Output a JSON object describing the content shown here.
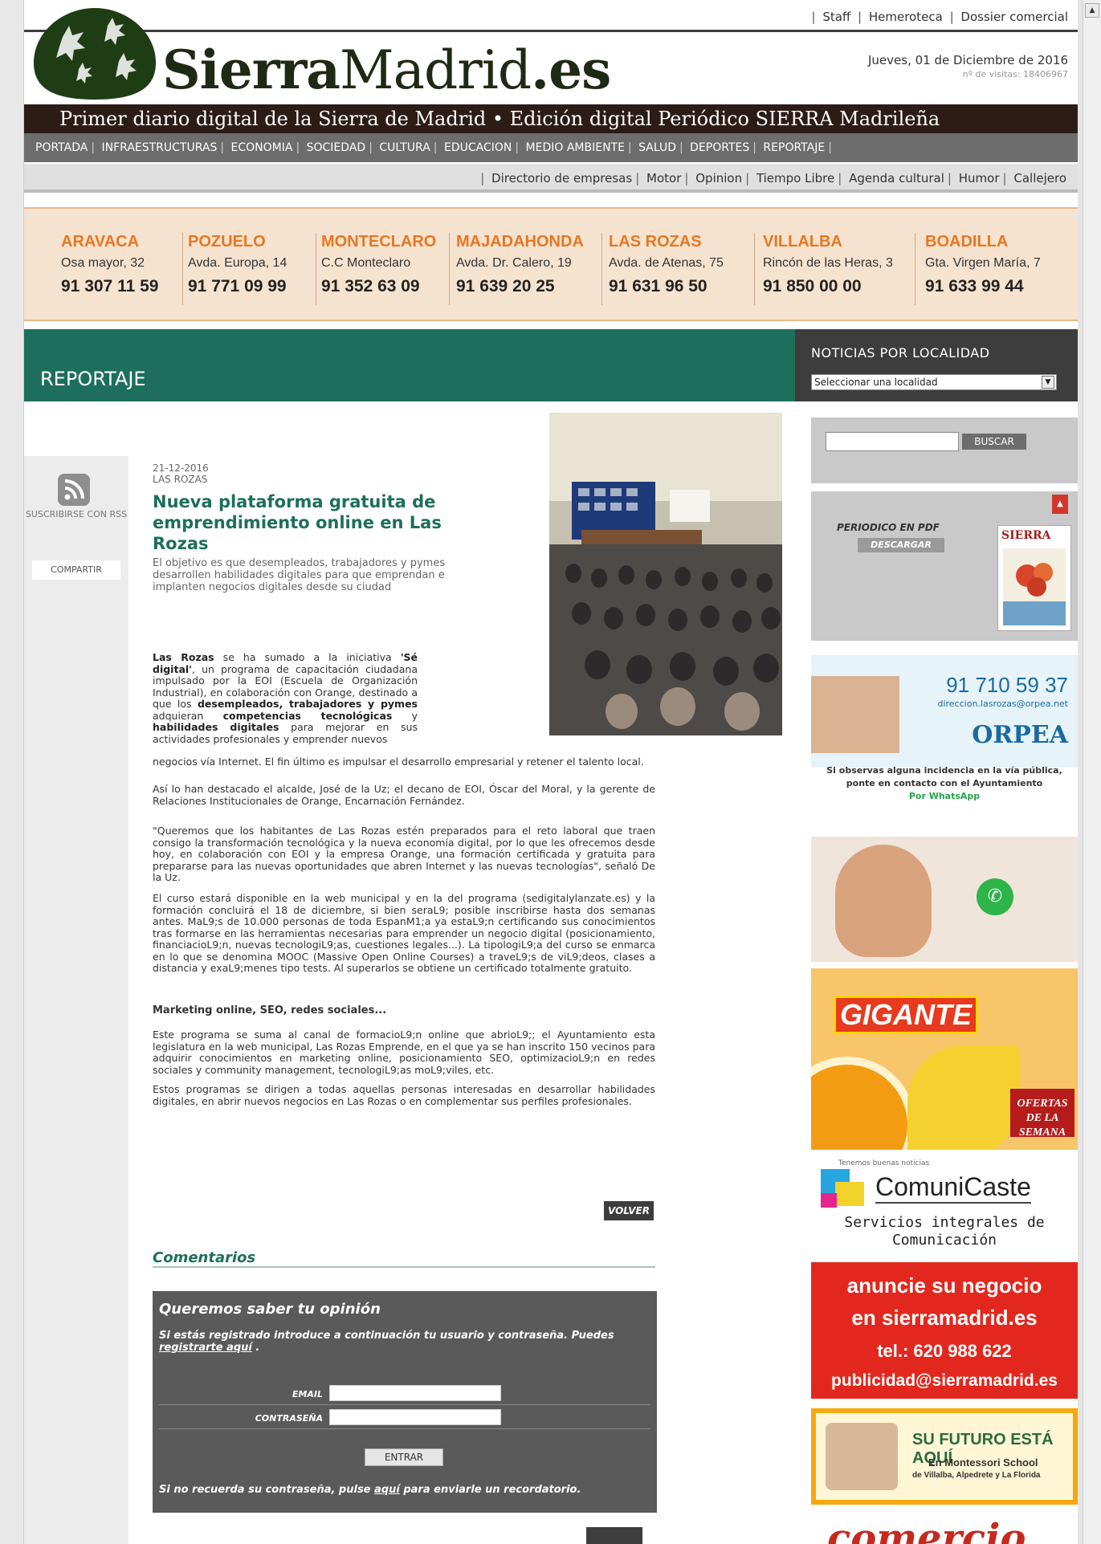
{
  "top_links": [
    "Staff",
    "Hemeroteca",
    "Dossier comercial"
  ],
  "logo": {
    "bold": "Sierra",
    "rest": "Madrid",
    "tld": ".es"
  },
  "date": "Jueves, 01 de Diciembre de 2016",
  "visits": "nº de visitas: 18406967",
  "tagline": "Primer diario digital de la Sierra de Madrid • Edición digital Periódico SIERRA Madrileña",
  "main_nav": [
    "PORTADA",
    "INFRAESTRUCTURAS",
    "ECONOMIA",
    "SOCIEDAD",
    "CULTURA",
    "EDUCACION",
    "MEDIO AMBIENTE",
    "SALUD",
    "DEPORTES",
    "REPORTAJE"
  ],
  "sub_nav": [
    "Directorio de empresas",
    "Motor",
    "Opinion",
    "Tiempo Libre",
    "Agenda cultural",
    "Humor",
    "Callejero"
  ],
  "locations": [
    {
      "name": "ARAVACA",
      "addr": "Osa mayor, 32",
      "tel": "91 307 11 59"
    },
    {
      "name": "POZUELO",
      "addr": "Avda. Europa, 14",
      "tel": "91 771 09 99"
    },
    {
      "name": "MONTECLARO",
      "addr": "C.C Monteclaro",
      "tel": "91 352 63 09"
    },
    {
      "name": "MAJADAHONDA",
      "addr": "Avda. Dr. Calero, 19",
      "tel": "91 639 20 25"
    },
    {
      "name": "LAS ROZAS",
      "addr": "Avda. de Atenas, 75",
      "tel": "91 631 96 50"
    },
    {
      "name": "VILLALBA",
      "addr": "Rincón de las Heras, 3",
      "tel": "91 850 00 00"
    },
    {
      "name": "BOADILLA",
      "addr": "Gta. Virgen María, 7",
      "tel": "91 633 99 44"
    }
  ],
  "section": "REPORTAJE",
  "locality": {
    "title": "NOTICIAS POR LOCALIDAD",
    "selected": "Seleccionar una localidad"
  },
  "share": {
    "rss": "SUSCRIBIRSE CON RSS",
    "share": "COMPARTIR"
  },
  "article": {
    "date": "21-12-2016",
    "location": "LAS ROZAS",
    "title": "Nueva plataforma gratuita de emprendimiento online en Las Rozas",
    "lead": "El objetivo es que desempleados, trabajadores y pymes desarrollen habilidades digitales para que emprendan e implanten negocios digitales desde su ciudad",
    "p1_a": "Las Rozas",
    "p1_b": " se ha sumado a la iniciativa ",
    "p1_c": "'Sé digital'",
    "p1_d": ", un programa de capacitación ciudadana impulsado por la EOI (Escuela de Organización Industrial), en colaboración con Orange, destinado a que los ",
    "p1_e": "desempleados, trabajadores y pymes",
    "p1_f": " adquieran ",
    "p1_g": "competencias tecnológicas",
    "p1_h": " y ",
    "p1_i": "habilidades digitales",
    "p1_j": " para mejorar en sus actividades profesionales y emprender nuevos",
    "p1_k": "negocios vía Internet. El fin último es impulsar el desarrollo empresarial y retener el talento local.",
    "p2": "Así lo han destacado el alcalde, José de la Uz; el decano de EOI, Óscar del Moral, y la gerente de Relaciones Institucionales de Orange, Encarnación Fernández.",
    "p3": "\"Queremos que los habitantes de Las Rozas estén preparados para el reto laboral que traen consigo la transformación tecnológica y la nueva economía digital, por lo que les ofrecemos desde hoy, en colaboración con EOI y la empresa Orange, una formación certificada y gratuita para prepararse para las nuevas oportunidades que abren Internet y las nuevas tecnologías\", señaló De la Uz.",
    "p4": "El curso estará disponible en la web municipal y en la del programa (sedigitalylanzate.es) y la formación concluirá el 18 de diciembre, si bien seraL9; posible inscribirse hasta dos semanas antes. MaL9;s de 10.000 personas de toda EspanM1;a ya estaL9;n certificando sus conocimientos tras formarse en las herramientas necesarias para emprender un negocio digital (posicionamiento, financiacioL9;n, nuevas tecnologiL9;as, cuestiones legales...). La tipologiL9;a del curso se enmarca en lo que se denomina MOOC (Massive Open Online Courses) a traveL9;s de viL9;deos, clases a distancia y exaL9;menes tipo tests. Al superarlos se obtiene un certificado totalmente gratuito.",
    "subtitle": "Marketing online, SEO, redes sociales...",
    "p5": "Este programa se suma al canal de formacioL9;n online que abrioL9;; el Ayuntamiento esta legislatura en la web municipal, Las Rozas Emprende, en el que ya se han inscrito 150 vecinos para adquirir conocimientos en marketing online, posicionamiento SEO, optimizacioL9;n en redes sociales y community management, tecnologiL9;as moL9;viles, etc.",
    "p6": "Estos programas se dirigen a todas aquellas personas interesadas en desarrollar habilidades digitales, en abrir nuevos negocios en Las Rozas o en complementar sus perfiles profesionales.",
    "back": "VOLVER"
  },
  "comments": {
    "title": "Comentarios",
    "box_title": "Queremos saber tu opinión",
    "intro_a": "Si estás registrado introduce a continuación tu usuario y contraseña. Puedes ",
    "intro_link": "registrarte aquí",
    "intro_b": " .",
    "email_label": "EMAIL",
    "password_label": "CONTRASEÑA",
    "submit": "ENTRAR",
    "reminder_a": "Si no recuerda su contraseña, pulse ",
    "reminder_link": "aquí",
    "reminder_b": " para enviarle un recordatorio."
  },
  "sidebar": {
    "search_button": "BUSCAR",
    "pdf_title": "PERIODICO EN PDF",
    "pdf_download": "DESCARGAR",
    "pdf_masthead": "SIERRA",
    "orpea_tel": "91 710 59 37",
    "orpea_email": "direccion.lasrozas@orpea.net",
    "orpea_brand": "ORPEA",
    "whatsapp_text": "Si observas alguna incidencia en la vía pública, ponte en contacto con el Ayuntamiento",
    "whatsapp_link": "Por WhatsApp",
    "gigante_logo": "GIGANTE",
    "gigante_offer": "OFERTAS DE LA SEMANA",
    "com_small": "Tenemos buenas noticias",
    "com_name": "ComuniCaste",
    "com_sub": "Servicios integrales de Comunicación",
    "ad_line1": "anuncie su negocio",
    "ad_line2": "en sierramadrid.es",
    "ad_tel": "tel.: 620 988 622",
    "ad_email": "publicidad@sierramadrid.es",
    "mont_title": "SU FUTURO ESTÁ AQUÍ",
    "mont_school": "En Montessori School",
    "mont_places": "de Villalba, Alpedrete y La Florida",
    "bottom_ad": "comercio"
  },
  "colors": {
    "accent_green": "#1d6f5b",
    "orange": "#e87721",
    "dark": "#2c1c15"
  }
}
